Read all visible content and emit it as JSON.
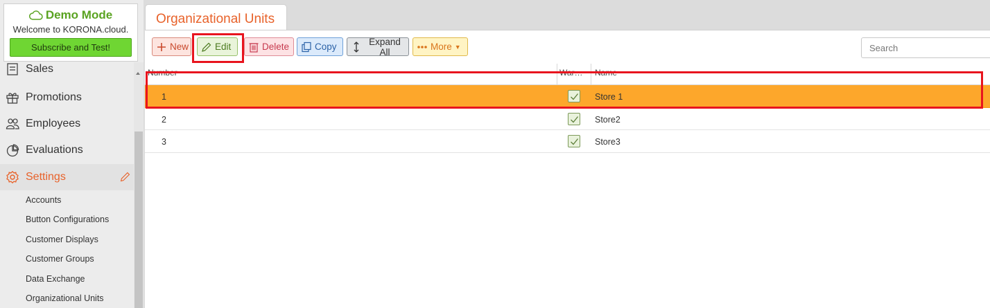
{
  "sidebar": {
    "demo": {
      "title": "Demo Mode",
      "welcome": "Welcome to KORONA.cloud.",
      "subscribe_label": "Subscribe and Test!"
    },
    "nav_items": [
      {
        "label": "Sales",
        "icon": "receipt-icon"
      },
      {
        "label": "Promotions",
        "icon": "gift-icon"
      },
      {
        "label": "Employees",
        "icon": "users-icon"
      },
      {
        "label": "Evaluations",
        "icon": "pie-chart-icon"
      },
      {
        "label": "Settings",
        "icon": "gear-icon",
        "active": true
      }
    ],
    "sub_items": [
      "Accounts",
      "Button Configurations",
      "Customer Displays",
      "Customer Groups",
      "Data Exchange",
      "Organizational Units"
    ]
  },
  "tab": {
    "title": "Organizational Units"
  },
  "toolbar": {
    "new_label": "New",
    "edit_label": "Edit",
    "delete_label": "Delete",
    "copy_label": "Copy",
    "expand_label": "Expand All",
    "more_label": "More",
    "search_placeholder": "Search"
  },
  "table": {
    "columns": [
      "Number",
      "War…",
      "Name"
    ],
    "rows": [
      {
        "number": "1",
        "warehouse": true,
        "name": "Store 1",
        "selected": true
      },
      {
        "number": "2",
        "warehouse": true,
        "name": "Store2"
      },
      {
        "number": "3",
        "warehouse": true,
        "name": "Store3"
      }
    ]
  },
  "colors": {
    "accent": "#e8622a",
    "selected_row": "#fda72b",
    "highlight": "#e8141e",
    "demo_green": "#5aa321"
  }
}
